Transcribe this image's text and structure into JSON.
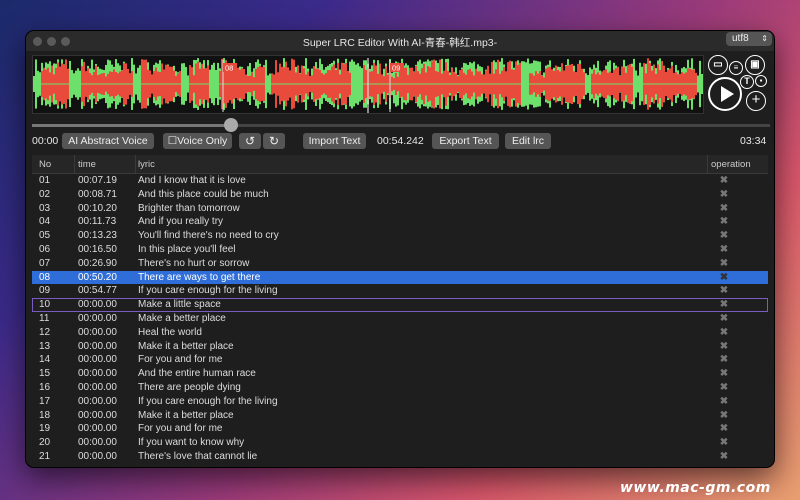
{
  "window": {
    "title": "Super LRC Editor With AI-青春-韩红.mp3-",
    "encoding": "utf8"
  },
  "waveform": {
    "markers": [
      "08",
      "09"
    ],
    "colors": {
      "background": "#111111",
      "wave": "#e84b3c",
      "noise": "#6ce06a"
    }
  },
  "side_buttons": {
    "icons": [
      "folder-icon",
      "save-icon",
      "text-icon",
      "delete-icon",
      "play-icon",
      "add-icon"
    ]
  },
  "controls": {
    "start_time": "00:00",
    "ai_voice_label": "AI Abstract Voice",
    "voice_only_label": "Voice Only",
    "undo_icon": "undo-icon",
    "redo_icon": "redo-icon",
    "import_label": "Import Text",
    "current_time": "00:54.242",
    "export_label": "Export Text",
    "edit_label": "Edit lrc",
    "end_time": "03:34",
    "progress": 0.27
  },
  "table": {
    "headers": {
      "no": "No",
      "time": "time",
      "lyric": "lyric",
      "operation": "operation"
    },
    "selected_index": 7,
    "focused_index": 9,
    "rows": [
      {
        "no": "01",
        "time": "00:07.19",
        "lyric": "And I know that it is love"
      },
      {
        "no": "02",
        "time": "00:08.71",
        "lyric": "And this place could be much"
      },
      {
        "no": "03",
        "time": "00:10.20",
        "lyric": "Brighter than tomorrow"
      },
      {
        "no": "04",
        "time": "00:11.73",
        "lyric": "And if you really try"
      },
      {
        "no": "05",
        "time": "00:13.23",
        "lyric": "You'll find there's no need to cry"
      },
      {
        "no": "06",
        "time": "00:16.50",
        "lyric": "In this place you'll feel"
      },
      {
        "no": "07",
        "time": "00:26.90",
        "lyric": "There's no hurt or sorrow"
      },
      {
        "no": "08",
        "time": "00:50.20",
        "lyric": "There are ways to get there"
      },
      {
        "no": "09",
        "time": "00:54.77",
        "lyric": "If you care enough for the living"
      },
      {
        "no": "10",
        "time": "00:00.00",
        "lyric": "Make a little space"
      },
      {
        "no": "11",
        "time": "00:00.00",
        "lyric": "Make a better place"
      },
      {
        "no": "12",
        "time": "00:00.00",
        "lyric": "Heal the world"
      },
      {
        "no": "13",
        "time": "00:00.00",
        "lyric": "Make it a better place"
      },
      {
        "no": "14",
        "time": "00:00.00",
        "lyric": "For you and for me"
      },
      {
        "no": "15",
        "time": "00:00.00",
        "lyric": "And the entire human race"
      },
      {
        "no": "16",
        "time": "00:00.00",
        "lyric": "There are people dying"
      },
      {
        "no": "17",
        "time": "00:00.00",
        "lyric": "If you care enough for the living"
      },
      {
        "no": "18",
        "time": "00:00.00",
        "lyric": "Make it a better place"
      },
      {
        "no": "19",
        "time": "00:00.00",
        "lyric": "For you and for me"
      },
      {
        "no": "20",
        "time": "00:00.00",
        "lyric": "If you want to know why"
      },
      {
        "no": "21",
        "time": "00:00.00",
        "lyric": "There's love that cannot lie"
      }
    ]
  },
  "watermark": "www.mac-gm.com"
}
